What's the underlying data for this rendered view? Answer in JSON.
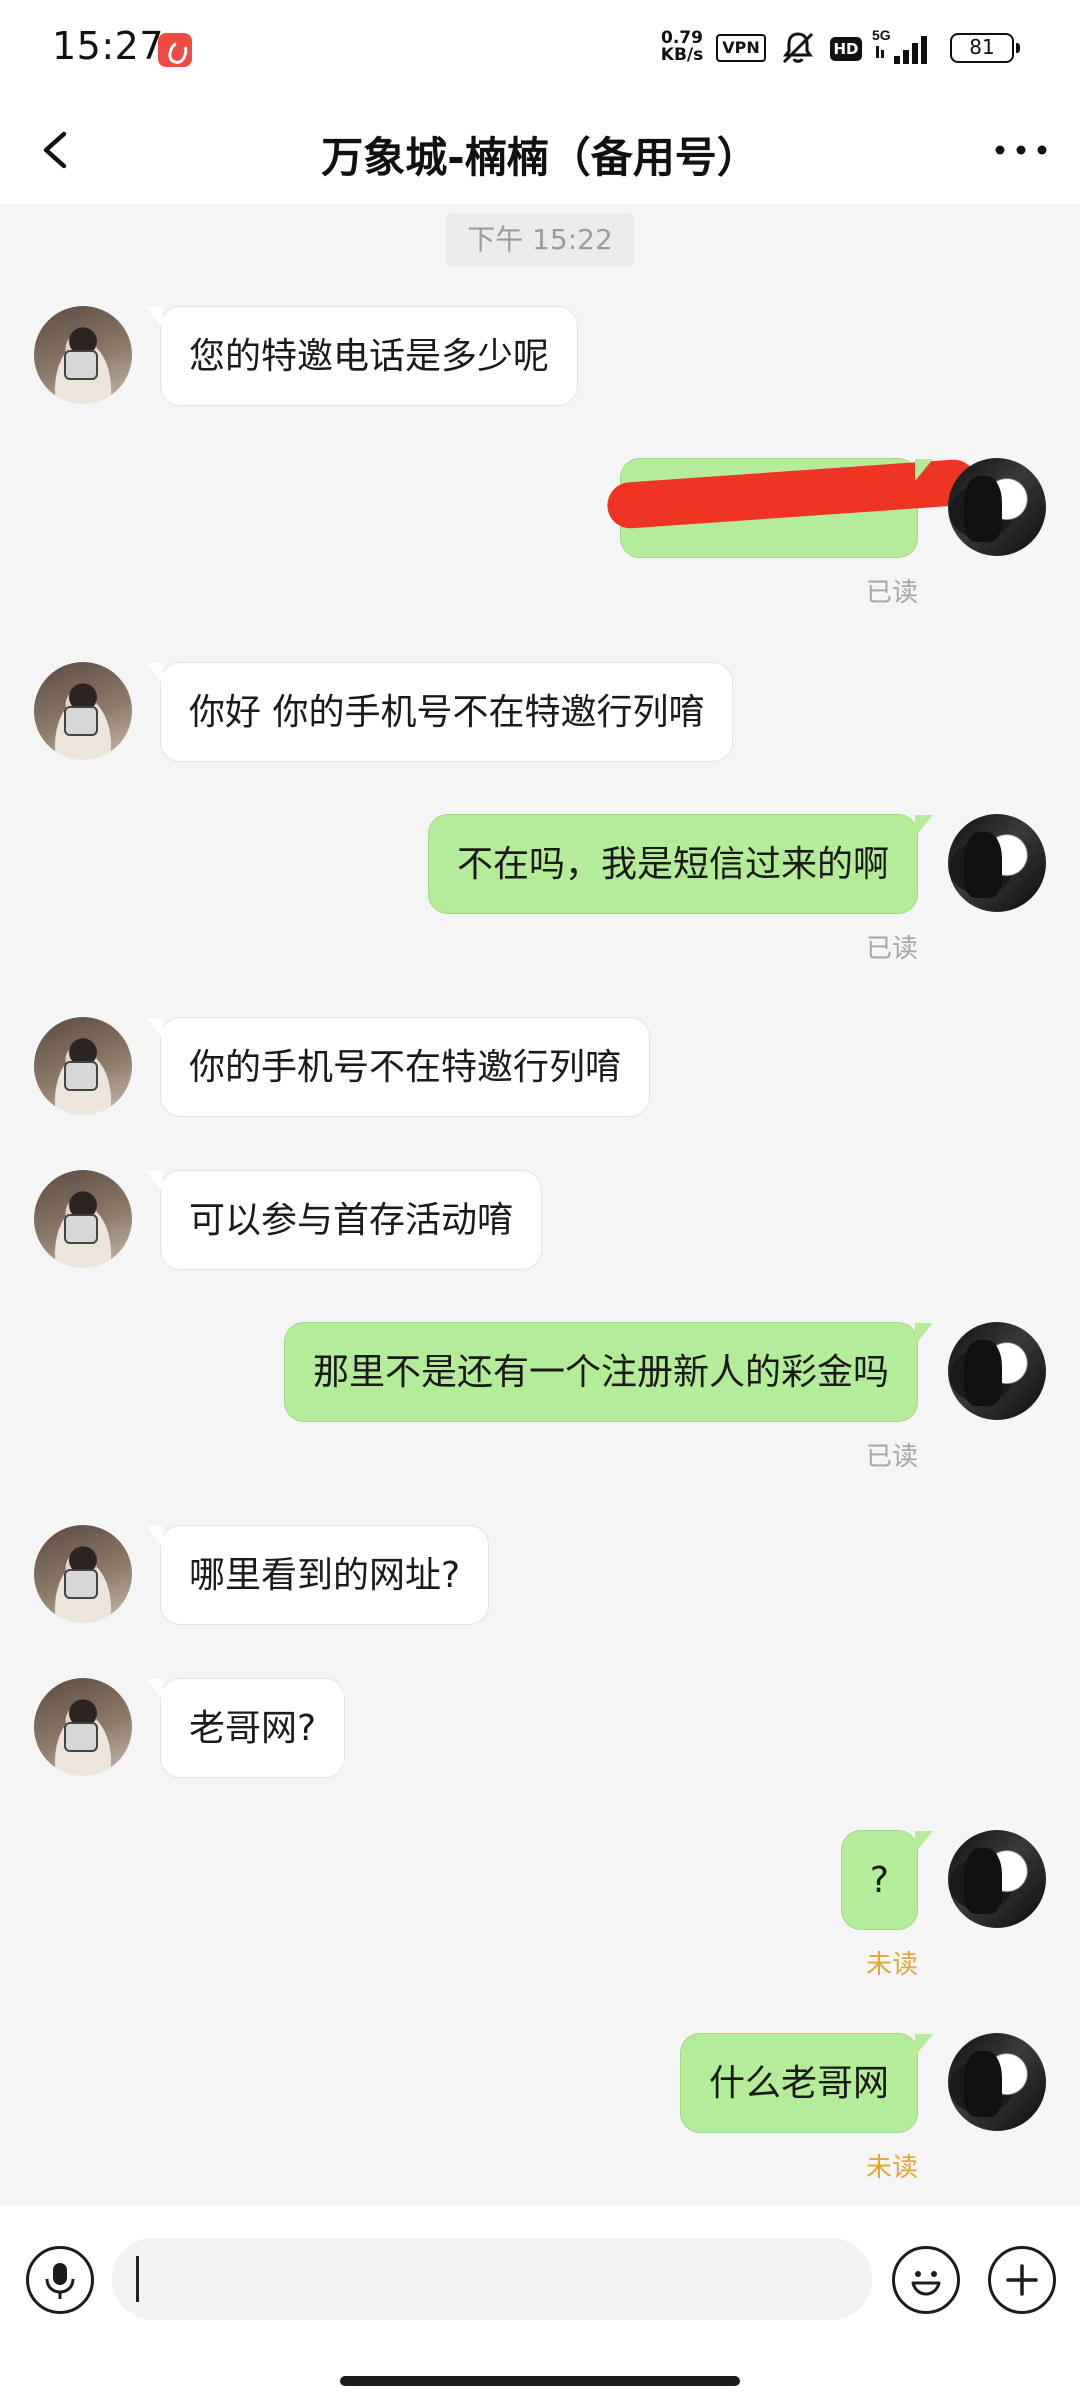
{
  "status_bar": {
    "time": "15:27",
    "net_speed_value": "0.79",
    "net_speed_unit": "KB/s",
    "vpn": "VPN",
    "hd": "HD",
    "network": "5G",
    "battery": "81",
    "icons": [
      "app-notification-icon",
      "mute-icon",
      "signal-icon",
      "battery-icon"
    ]
  },
  "header": {
    "title": "万象城-楠楠（备用号）",
    "back_icon": "chevron-left-icon",
    "more_icon": "more-dots-icon"
  },
  "chat": {
    "time_divider": "下午 15:22",
    "messages": [
      {
        "side": "in",
        "text": "您的特邀电话是多少呢"
      },
      {
        "side": "out",
        "text": "",
        "redacted": true,
        "receipt": "已读"
      },
      {
        "side": "in",
        "text": "你好 你的手机号不在特邀行列唷"
      },
      {
        "side": "out",
        "text": "不在吗，我是短信过来的啊",
        "receipt": "已读"
      },
      {
        "side": "in",
        "text": "你的手机号不在特邀行列唷"
      },
      {
        "side": "in",
        "text": "可以参与首存活动唷"
      },
      {
        "side": "out",
        "text": "那里不是还有一个注册新人的彩金吗",
        "receipt": "已读"
      },
      {
        "side": "in",
        "text": "哪里看到的网址?"
      },
      {
        "side": "in",
        "text": "老哥网?"
      },
      {
        "side": "out",
        "text": "?",
        "receipt": "未读"
      },
      {
        "side": "out",
        "text": "什么老哥网",
        "receipt": "未读"
      }
    ]
  },
  "input_bar": {
    "input_value": "",
    "voice_icon": "microphone-icon",
    "emoji_icon": "emoji-icon",
    "add_icon": "plus-icon"
  },
  "colors": {
    "incoming_bubble": "#ffffff",
    "outgoing_bubble": "#b5ec9a",
    "read_receipt": "#a6a6a6",
    "unread_receipt": "#e2a633",
    "redaction": "#ee3422",
    "background": "#f5f5f5"
  }
}
